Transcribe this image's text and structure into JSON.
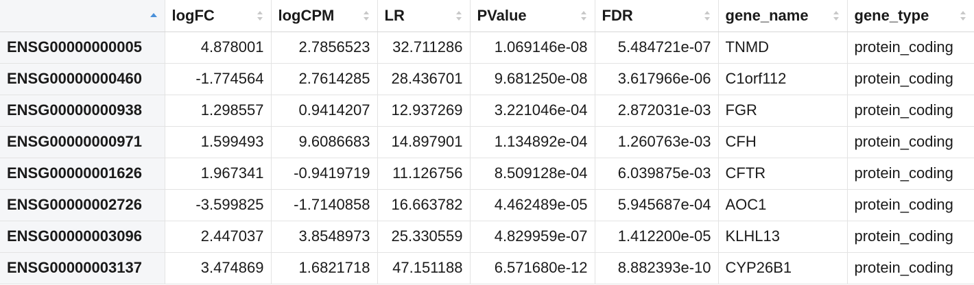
{
  "table": {
    "columns": [
      {
        "label": "",
        "sort": "asc"
      },
      {
        "label": "logFC",
        "sort": "none"
      },
      {
        "label": "logCPM",
        "sort": "none"
      },
      {
        "label": "LR",
        "sort": "none"
      },
      {
        "label": "PValue",
        "sort": "none"
      },
      {
        "label": "FDR",
        "sort": "none"
      },
      {
        "label": "gene_name",
        "sort": "none"
      },
      {
        "label": "gene_type",
        "sort": "none"
      }
    ],
    "rows": [
      [
        "ENSG00000000005",
        "4.878001",
        "2.7856523",
        "32.711286",
        "1.069146e-08",
        "5.484721e-07",
        "TNMD",
        "protein_coding"
      ],
      [
        "ENSG00000000460",
        "-1.774564",
        "2.7614285",
        "28.436701",
        "9.681250e-08",
        "3.617966e-06",
        "C1orf112",
        "protein_coding"
      ],
      [
        "ENSG00000000938",
        "1.298557",
        "0.9414207",
        "12.937269",
        "3.221046e-04",
        "2.872031e-03",
        "FGR",
        "protein_coding"
      ],
      [
        "ENSG00000000971",
        "1.599493",
        "9.6086683",
        "14.897901",
        "1.134892e-04",
        "1.260763e-03",
        "CFH",
        "protein_coding"
      ],
      [
        "ENSG00000001626",
        "1.967341",
        "-0.9419719",
        "11.126756",
        "8.509128e-04",
        "6.039875e-03",
        "CFTR",
        "protein_coding"
      ],
      [
        "ENSG00000002726",
        "-3.599825",
        "-1.7140858",
        "16.663782",
        "4.462489e-05",
        "5.945687e-04",
        "AOC1",
        "protein_coding"
      ],
      [
        "ENSG00000003096",
        "2.447037",
        "3.8548973",
        "25.330559",
        "4.829959e-07",
        "1.412200e-05",
        "KLHL13",
        "protein_coding"
      ],
      [
        "ENSG00000003137",
        "3.474869",
        "1.6821718",
        "47.151188",
        "6.571680e-12",
        "8.882393e-10",
        "CYP26B1",
        "protein_coding"
      ]
    ]
  },
  "colors": {
    "sort_active": "#4a90d9",
    "sort_inactive": "#c8c8c8",
    "rowname_bg": "#f5f6f8",
    "border": "#e3e3e3"
  },
  "icons": {
    "sort_ascending": "sort-ascending-icon",
    "sort_neutral": "sort-icon"
  }
}
